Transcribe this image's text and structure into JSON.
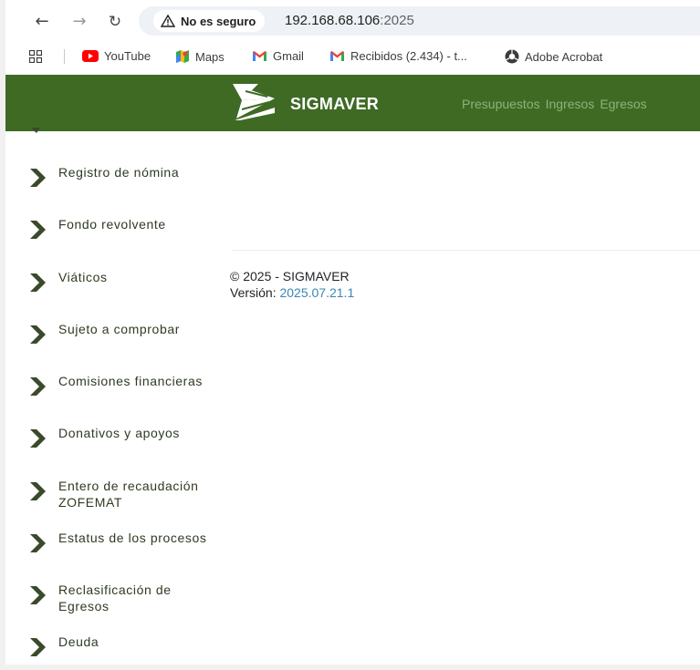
{
  "browser": {
    "security_label": "No es seguro",
    "url_host": "192.168.68.106",
    "url_port": ":2025"
  },
  "bookmarks": [
    {
      "label": "YouTube",
      "icon": "youtube-icon"
    },
    {
      "label": "Maps",
      "icon": "maps-icon"
    },
    {
      "label": "Gmail",
      "icon": "gmail-icon"
    },
    {
      "label": "Recibidos (2.434) - t...",
      "icon": "gmail-icon"
    },
    {
      "label": "Adobe Acrobat",
      "icon": "acrobat-icon"
    }
  ],
  "header": {
    "brand": "SIGMAVER",
    "nav": [
      "Presupuestos",
      "Ingresos",
      "Egresos"
    ],
    "background_color": "#3e6a24",
    "nav_color": "#8fb27a"
  },
  "sidebar": {
    "items": [
      {
        "label": "Registro de nómina"
      },
      {
        "label": "Fondo revolvente"
      },
      {
        "label": "Viáticos"
      },
      {
        "label": "Sujeto a comprobar"
      },
      {
        "label": "Comisiones financieras"
      },
      {
        "label": "Donativos y apoyos"
      },
      {
        "label": "Entero de recaudación ZOFEMAT"
      },
      {
        "label": "Estatus de los procesos"
      },
      {
        "label": "Reclasificación de Egresos"
      },
      {
        "label": "Deuda"
      }
    ],
    "chevron_color": "#3a4a2a"
  },
  "footer": {
    "copyright": "© 2025 - SIGMAVER",
    "version_label": "Versión:",
    "version_value": "2025.07.21.1"
  }
}
